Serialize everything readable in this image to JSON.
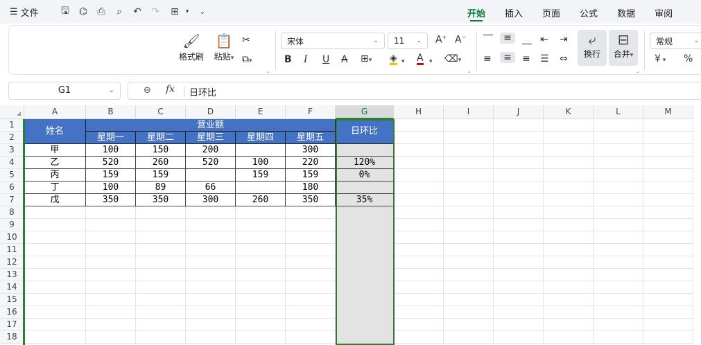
{
  "topbar": {
    "file_label": "文件",
    "tabs": [
      {
        "label": "开始",
        "active": true
      },
      {
        "label": "插入",
        "active": false
      },
      {
        "label": "页面",
        "active": false
      },
      {
        "label": "公式",
        "active": false
      },
      {
        "label": "数据",
        "active": false
      },
      {
        "label": "审阅",
        "active": false
      }
    ]
  },
  "ribbon": {
    "format_painter": "格式刷",
    "paste": "粘贴",
    "font_name": "宋体",
    "font_size": "11",
    "wrap": "换行",
    "merge": "合并",
    "number_format": "常规",
    "currency_symbol": "¥",
    "percent_symbol": "%"
  },
  "formula_bar": {
    "name_box": "G1",
    "fx": "fx",
    "content": "日环比"
  },
  "columns": [
    "A",
    "B",
    "C",
    "D",
    "E",
    "F",
    "G",
    "H",
    "I",
    "J",
    "K",
    "L",
    "M"
  ],
  "rows": [
    "1",
    "2",
    "3",
    "4",
    "5",
    "6",
    "7",
    "8",
    "9",
    "10",
    "11",
    "12",
    "13",
    "14",
    "15",
    "16",
    "17",
    "18"
  ],
  "sheet": {
    "header_name": "姓名",
    "header_group": "营业额",
    "header_ratio": "日环比",
    "weekdays": [
      "星期一",
      "星期二",
      "星期三",
      "星期四",
      "星期五"
    ],
    "data": [
      {
        "name": "甲",
        "vals": [
          "100",
          "150",
          "200",
          "",
          "300"
        ],
        "ratio": ""
      },
      {
        "name": "乙",
        "vals": [
          "520",
          "260",
          "520",
          "100",
          "220"
        ],
        "ratio": "120%"
      },
      {
        "name": "丙",
        "vals": [
          "159",
          "159",
          "",
          "159",
          "159"
        ],
        "ratio": "0%"
      },
      {
        "name": "丁",
        "vals": [
          "100",
          "89",
          "66",
          "",
          "180"
        ],
        "ratio": ""
      },
      {
        "name": "戊",
        "vals": [
          "350",
          "350",
          "300",
          "260",
          "350"
        ],
        "ratio": "35%"
      }
    ]
  },
  "colors": {
    "accent": "#0b7a3b",
    "header_fill": "#4472c4",
    "selection": "#2e7d32"
  }
}
